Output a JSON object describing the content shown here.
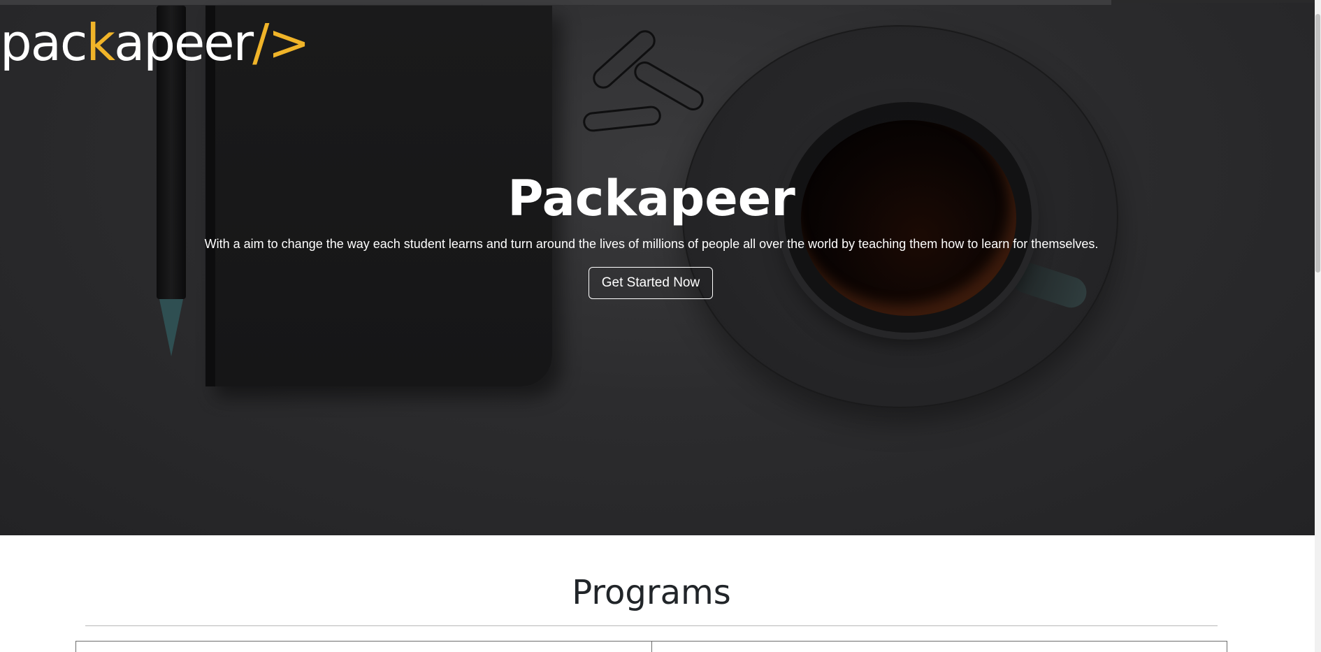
{
  "brand": {
    "logo_part1": "pac",
    "logo_accent_left": "k",
    "logo_part2": "apeer",
    "logo_accent_right": "/>",
    "accent_color": "#f0b429"
  },
  "hero": {
    "title": "Packapeer",
    "subtitle": "With a aim to change the way each student learns and turn around the lives of millions of people all over the world by teaching them how to learn for themselves.",
    "cta_label": "Get Started Now"
  },
  "programs": {
    "title": "Programs"
  }
}
